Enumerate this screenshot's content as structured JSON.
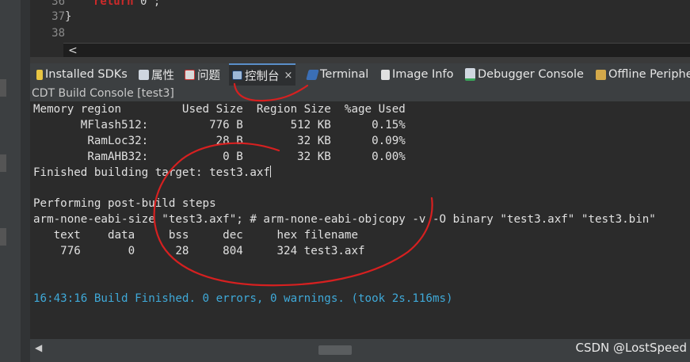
{
  "editor": {
    "lines": [
      {
        "num": "36",
        "keyword": "return",
        "rest": " 0 ;"
      },
      {
        "num": "37",
        "text": "}"
      },
      {
        "num": "38",
        "text": ""
      }
    ]
  },
  "scroll": {
    "left_arrow": "<"
  },
  "tabs": [
    {
      "label": "Installed SDKs",
      "icon": "sdk-icon"
    },
    {
      "label": "属性",
      "icon": "properties-icon"
    },
    {
      "label": "问题",
      "icon": "problems-icon"
    },
    {
      "label": "控制台",
      "icon": "console-icon",
      "close": "×"
    },
    {
      "label": "Terminal",
      "icon": "terminal-icon"
    },
    {
      "label": "Image Info",
      "icon": "image-info-icon"
    },
    {
      "label": "Debugger Console",
      "icon": "debugger-console-icon"
    },
    {
      "label": "Offline Periphe",
      "icon": "offline-peripherals-icon"
    }
  ],
  "console": {
    "title": "CDT Build Console [test3]",
    "lines": [
      "Memory region         Used Size  Region Size  %age Used",
      "       MFlash512:         776 B       512 KB      0.15%",
      "        RamLoc32:          28 B        32 KB      0.09%",
      "        RamAHB32:           0 B        32 KB      0.00%",
      "Finished building target: test3.axf",
      "",
      "Performing post-build steps",
      "arm-none-eabi-size \"test3.axf\"; # arm-none-eabi-objcopy -v -O binary \"test3.axf\" \"test3.bin\"",
      "   text    data     bss     dec     hex filename",
      "    776       0      28     804     324 test3.axf",
      "",
      "",
      "16:43:16 Build Finished. 0 errors, 0 warnings. (took 2s.116ms)"
    ]
  },
  "watermark": "CSDN @LostSpeed"
}
